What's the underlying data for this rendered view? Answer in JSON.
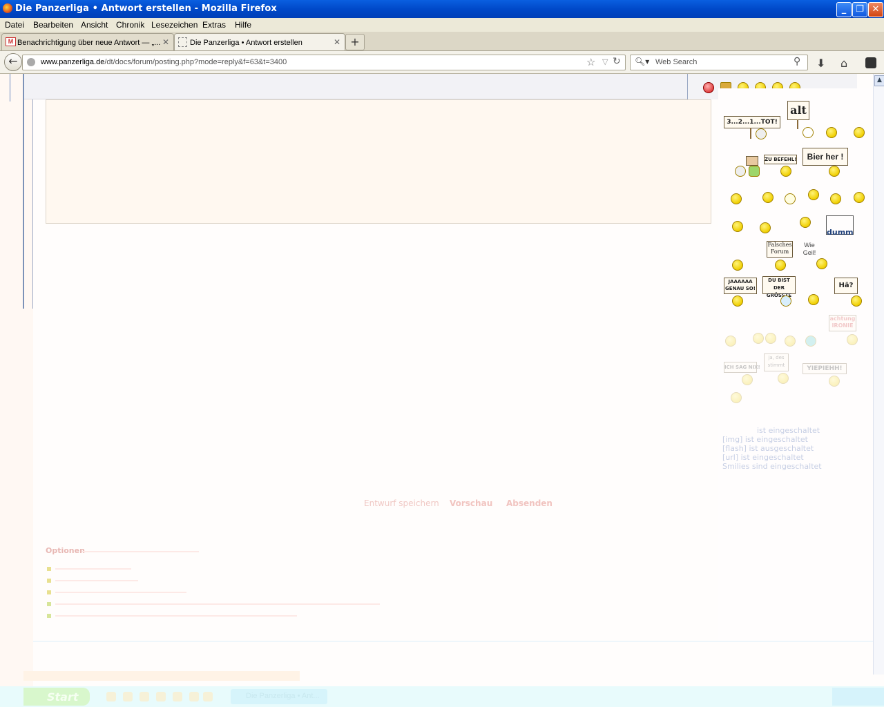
{
  "window": {
    "title": "Die Panzerliga • Antwort erstellen - Mozilla Firefox",
    "buttons": {
      "minimize": "_",
      "maximize": "❐",
      "close": "✕"
    }
  },
  "menu": [
    "Datei",
    "Bearbeiten",
    "Ansicht",
    "Chronik",
    "Lesezeichen",
    "Extras",
    "Hilfe"
  ],
  "tabs": [
    {
      "label": "Benachrichtigung über neue Antwort — „...",
      "icon": "gmail-icon",
      "active": false
    },
    {
      "label": "Die Panzerliga • Antwort erstellen",
      "icon": "page-icon",
      "active": true
    }
  ],
  "tab_close": "✕",
  "new_tab": "+",
  "nav": {
    "url_domain": "www.panzerliga.de",
    "url_path": "/dt/docs/forum/posting.php?mode=reply&f=63&t=3400",
    "search_placeholder": "Web Search"
  },
  "smilie_signs": {
    "countdown": "3...2...1...TOT!",
    "alt": "alt",
    "zu_befehl": "ZU BEFEHL!",
    "bier": "Bier her !",
    "dumm": "dumm",
    "falsches_forum": "Falsches Forum",
    "wie_geil": "Wie Geil!",
    "genau_so": "JAAAAAA GENAU SO!",
    "groesste": "DU BIST DER GRÖSSTE",
    "hae": "Hä?",
    "ironie": "achtung IRONIE",
    "ich_sag": "ICH SAG NIX!",
    "ja_des": "ja, des stimmt",
    "yiepiehh": "YIEPIEHH!"
  },
  "bbcode": {
    "line1": "ist eingeschaltet",
    "img": "[img] ist eingeschaltet",
    "flash": "[flash] ist ausgeschaltet",
    "url": "[url] ist eingeschaltet",
    "smilies": "Smilies sind eingeschaltet"
  },
  "buttons": {
    "draft": "Entwurf speichern",
    "preview": "Vorschau",
    "submit": "Absenden"
  },
  "options": {
    "title": "Optionen"
  },
  "taskbar": {
    "start": "Start",
    "window": "Die Panzerliga • Ant..."
  }
}
